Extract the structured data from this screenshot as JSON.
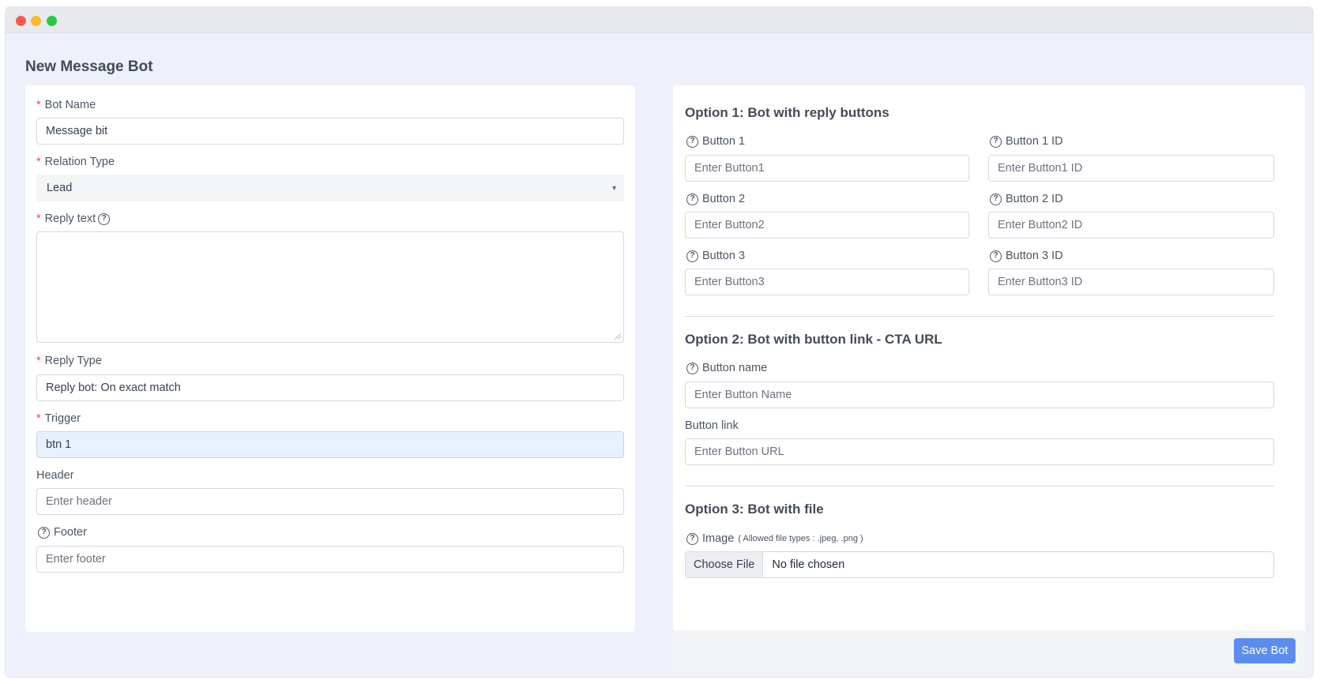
{
  "page": {
    "title": "New Message Bot"
  },
  "left": {
    "bot_name": {
      "label": "Bot Name",
      "value": "Message bit"
    },
    "relation_type": {
      "label": "Relation Type",
      "value": "Lead"
    },
    "reply_text": {
      "label": "Reply text",
      "value": ""
    },
    "reply_type": {
      "label": "Reply Type",
      "value": "Reply bot: On exact match"
    },
    "trigger": {
      "label": "Trigger",
      "value": "btn 1"
    },
    "header": {
      "label": "Header",
      "placeholder": "Enter header"
    },
    "footer": {
      "label": "Footer",
      "placeholder": "Enter footer"
    }
  },
  "right": {
    "option1": {
      "title": "Option 1: Bot with reply buttons",
      "button1": {
        "label": "Button 1",
        "placeholder": "Enter Button1"
      },
      "button1_id": {
        "label": "Button 1 ID",
        "placeholder": "Enter Button1 ID"
      },
      "button2": {
        "label": "Button 2",
        "placeholder": "Enter Button2"
      },
      "button2_id": {
        "label": "Button 2 ID",
        "placeholder": "Enter Button2 ID"
      },
      "button3": {
        "label": "Button 3",
        "placeholder": "Enter Button3"
      },
      "button3_id": {
        "label": "Button 3 ID",
        "placeholder": "Enter Button3 ID"
      }
    },
    "option2": {
      "title": "Option 2: Bot with button link - CTA URL",
      "button_name": {
        "label": "Button name",
        "placeholder": "Enter Button Name"
      },
      "button_link": {
        "label": "Button link",
        "placeholder": "Enter Button URL"
      }
    },
    "option3": {
      "title": "Option 3: Bot with file",
      "image": {
        "label": "Image",
        "note": "( Allowed file types : .jpeg, .png )",
        "choose_label": "Choose File",
        "status": "No file chosen"
      }
    },
    "save_label": "Save Bot"
  },
  "icons": {
    "help": "question-circle-icon",
    "dropdown": "caret-down-icon",
    "required": "asterisk"
  },
  "colors": {
    "primary": "#5b8def",
    "required": "#e5484d",
    "background": "#eef1fb",
    "highlight": "#e8f0fe"
  }
}
